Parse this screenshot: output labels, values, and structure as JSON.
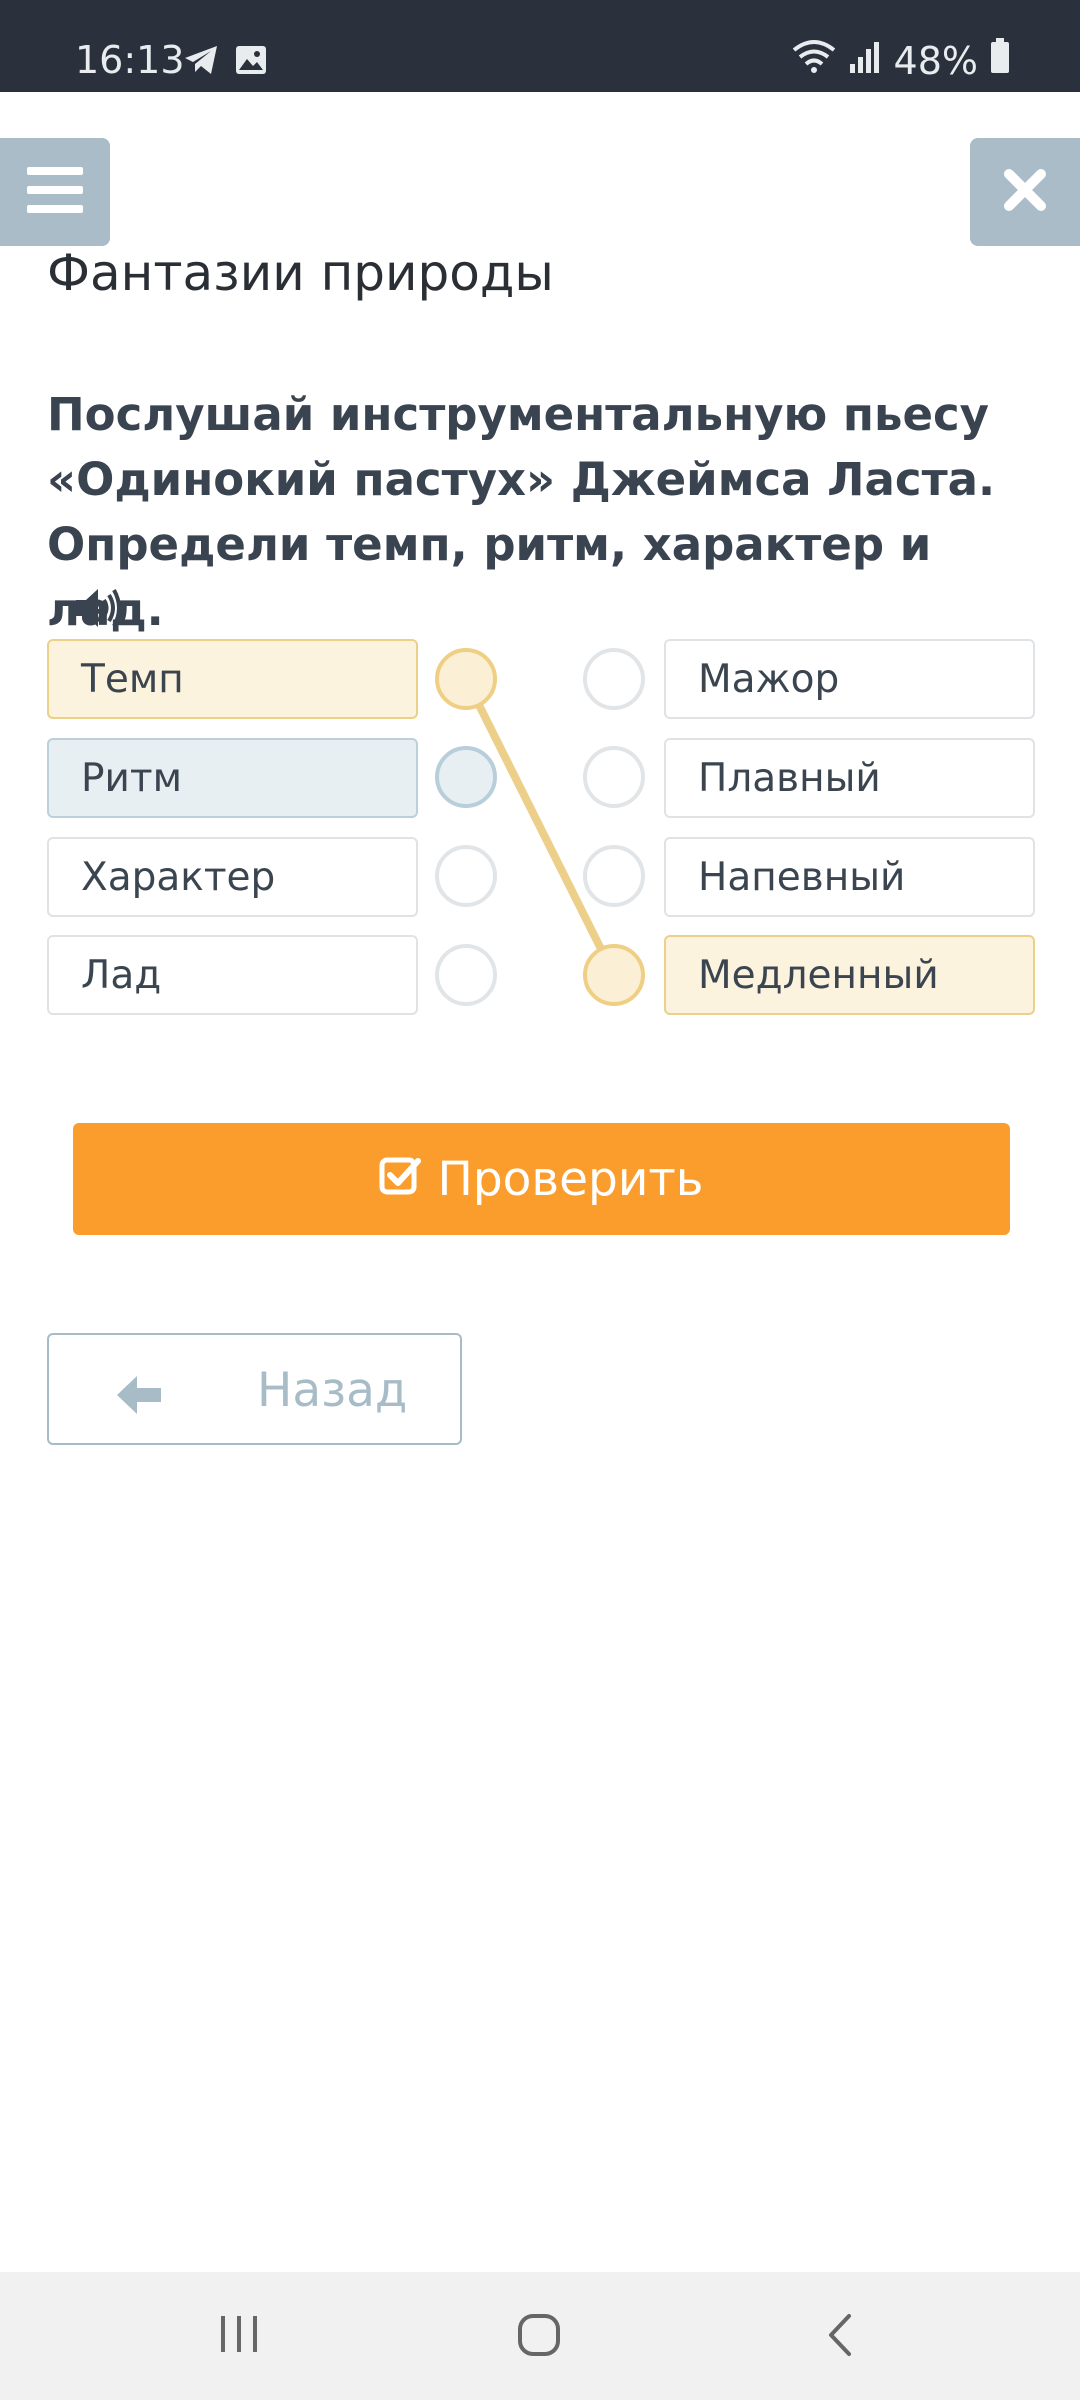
{
  "status_bar": {
    "time": "16:13",
    "battery": "48%"
  },
  "header": {
    "title": "Фантазии природы"
  },
  "question": {
    "text": "Послушай инструментальную пьесу «Одинокий пастух» Джеймса Ласта. Определи темп, ритм, характер и лад."
  },
  "matching": {
    "left_items": [
      {
        "label": "Темп",
        "state": "selected-yellow"
      },
      {
        "label": "Ритм",
        "state": "selected-blue"
      },
      {
        "label": "Характер",
        "state": "default"
      },
      {
        "label": "Лад",
        "state": "default"
      }
    ],
    "right_items": [
      {
        "label": "Мажор",
        "state": "default"
      },
      {
        "label": "Плавный",
        "state": "default"
      },
      {
        "label": "Напевный",
        "state": "default"
      },
      {
        "label": "Медленный",
        "state": "selected-yellow"
      }
    ],
    "connections": [
      {
        "from": "Темп",
        "to": "Медленный",
        "color": "#ecd08a"
      }
    ]
  },
  "actions": {
    "check_label": "Проверить",
    "back_label": "Назад"
  },
  "colors": {
    "accent": "#fb9d2c",
    "muted": "#a9bcc8",
    "status_bar": "#2b313c",
    "selection_yellow": "#ecd08a",
    "selection_blue": "#bcd0dc"
  },
  "icons": [
    "telegram-icon",
    "gallery-icon",
    "wifi-icon",
    "signal-icon",
    "battery-icon",
    "menu-icon",
    "close-icon",
    "speaker-icon",
    "checkbox-icon",
    "arrow-left-icon",
    "recent-apps-icon",
    "home-icon",
    "back-nav-icon"
  ]
}
